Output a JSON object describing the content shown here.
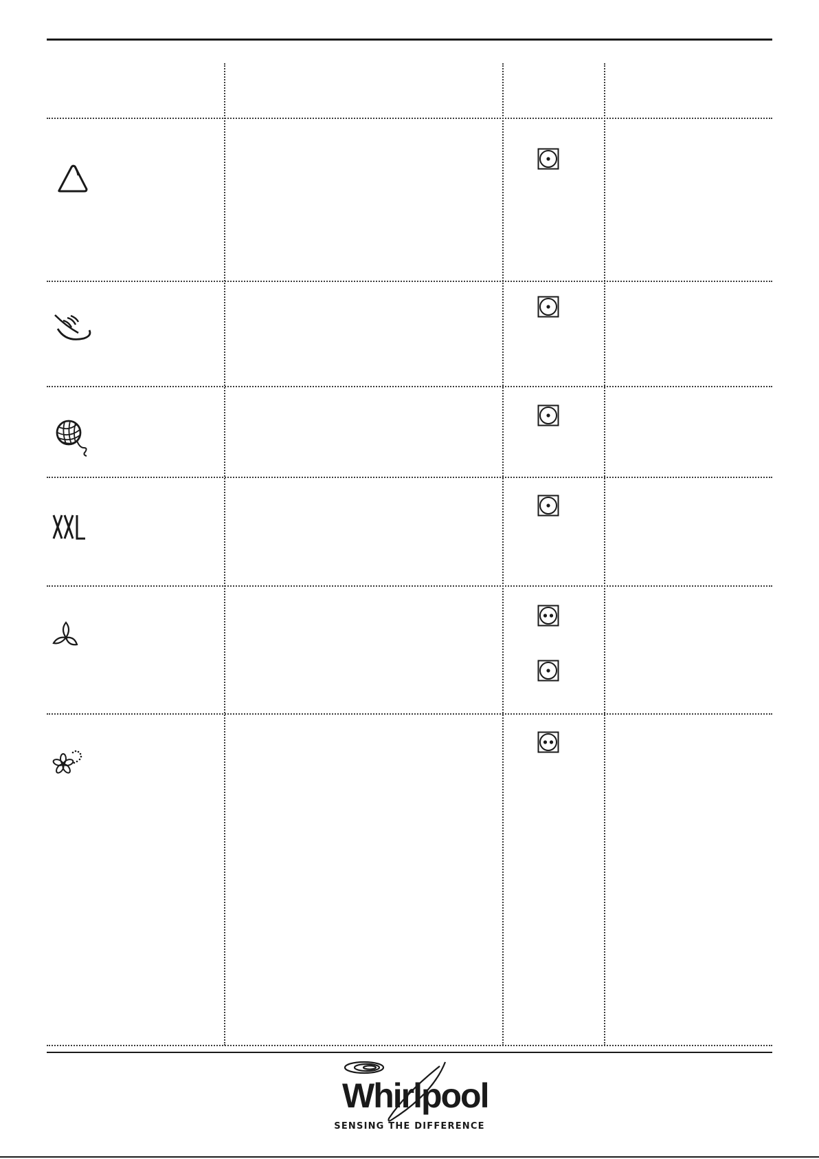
{
  "brand": {
    "name": "Whirlpool",
    "tagline": "SENSING THE DIFFERENCE"
  },
  "programs": [
    {
      "icon": "cotton-bag-icon",
      "dry_symbols": [
        [
          "single-dot-dry-icon"
        ]
      ]
    },
    {
      "icon": "feather-bowl-icon",
      "dry_symbols": [
        [
          "single-dot-dry-icon"
        ]
      ]
    },
    {
      "icon": "wool-ball-icon",
      "dry_symbols": [
        [
          "single-dot-dry-icon"
        ]
      ]
    },
    {
      "icon": "xxl-icon",
      "icon_text": "XXL",
      "dry_symbols": [
        [
          "single-dot-dry-icon"
        ]
      ]
    },
    {
      "icon": "fan-icon",
      "dry_symbols": [
        [
          "double-dot-dry-icon"
        ],
        [
          "single-dot-dry-icon"
        ]
      ]
    },
    {
      "icon": "flower-fresh-icon",
      "dry_symbols": [
        [
          "double-dot-dry-icon"
        ]
      ]
    }
  ],
  "colors": {
    "ink": "#1a1a1a",
    "rule": "#3a3a3a"
  }
}
